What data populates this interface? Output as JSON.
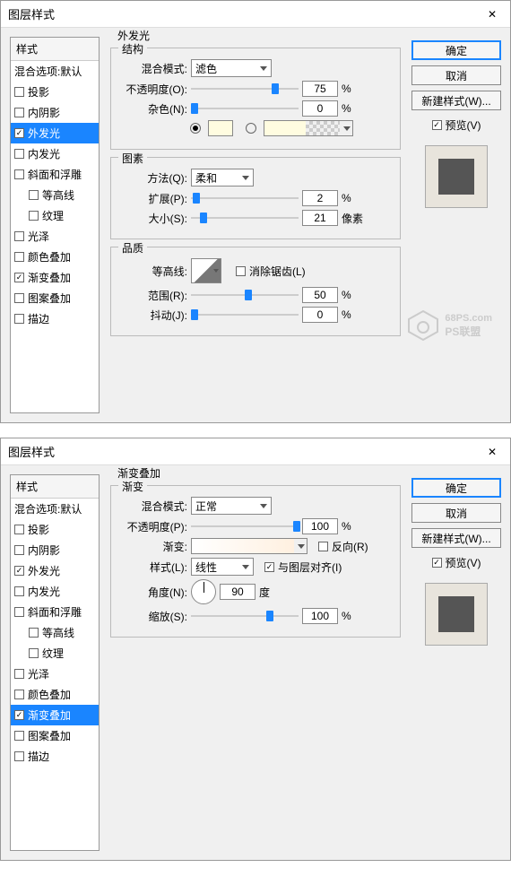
{
  "dialog_title": "图层样式",
  "close_glyph": "✕",
  "sidebar": {
    "header": "样式",
    "blend_default": "混合选项:默认",
    "items": [
      {
        "label": "投影",
        "checked": false
      },
      {
        "label": "内阴影",
        "checked": false
      },
      {
        "label": "外发光",
        "checked": true
      },
      {
        "label": "内发光",
        "checked": false
      },
      {
        "label": "斜面和浮雕",
        "checked": false
      },
      {
        "label": "等高线",
        "checked": false,
        "indent": true
      },
      {
        "label": "纹理",
        "checked": false,
        "indent": true
      },
      {
        "label": "光泽",
        "checked": false
      },
      {
        "label": "颜色叠加",
        "checked": false
      },
      {
        "label": "渐变叠加",
        "checked": true
      },
      {
        "label": "图案叠加",
        "checked": false
      },
      {
        "label": "描边",
        "checked": false
      }
    ]
  },
  "panel1": {
    "main_title": "外发光",
    "structure_title": "结构",
    "blend_label": "混合模式:",
    "blend_value": "滤色",
    "opacity_label": "不透明度(O):",
    "opacity_value": "75",
    "percent": "%",
    "noise_label": "杂色(N):",
    "noise_value": "0",
    "color_swatch": "#fffce0",
    "elements_title": "图素",
    "method_label": "方法(Q):",
    "method_value": "柔和",
    "spread_label": "扩展(P):",
    "spread_value": "2",
    "size_label": "大小(S):",
    "size_value": "21",
    "px": "像素",
    "quality_title": "品质",
    "contour_label": "等高线:",
    "antialias_label": "消除锯齿(L)",
    "range_label": "范围(R):",
    "range_value": "50",
    "jitter_label": "抖动(J):",
    "jitter_value": "0"
  },
  "panel2": {
    "main_title": "渐变叠加",
    "gradient_group_title": "渐变",
    "blend_label": "混合模式:",
    "blend_value": "正常",
    "opacity_label": "不透明度(P):",
    "opacity_value": "100",
    "percent": "%",
    "gradient_label": "渐变:",
    "reverse_label": "反向(R)",
    "style_label": "样式(L):",
    "style_value": "线性",
    "align_label": "与图层对齐(I)",
    "angle_label": "角度(N):",
    "angle_value": "90",
    "deg": "度",
    "scale_label": "缩放(S):",
    "scale_value": "100"
  },
  "buttons": {
    "ok": "确定",
    "cancel": "取消",
    "new_style": "新建样式(W)...",
    "preview": "预览(V)"
  },
  "watermark": {
    "site": "68PS.com",
    "brand": "PS联盟"
  }
}
